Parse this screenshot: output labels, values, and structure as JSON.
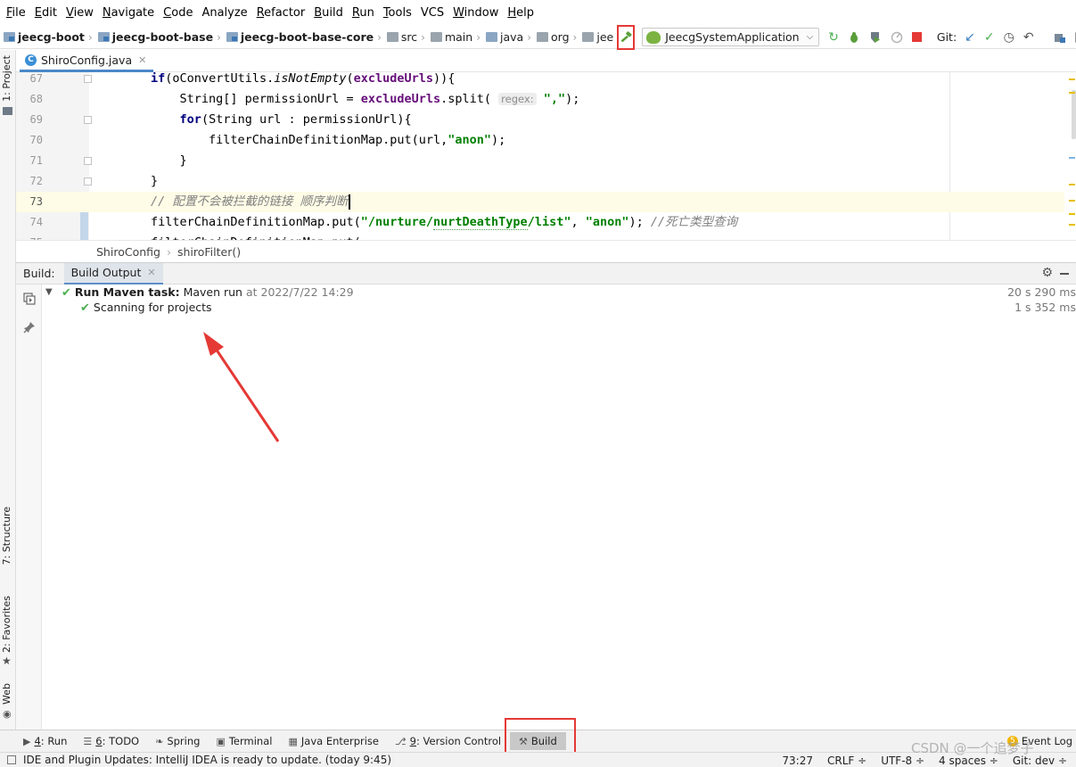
{
  "menu": [
    {
      "label": "File",
      "mnemonic": "F",
      "rest": "ile"
    },
    {
      "label": "Edit",
      "mnemonic": "E",
      "rest": "dit"
    },
    {
      "label": "View",
      "mnemonic": "V",
      "rest": "iew"
    },
    {
      "label": "Navigate",
      "mnemonic": "N",
      "rest": "avigate"
    },
    {
      "label": "Code",
      "mnemonic": "C",
      "rest": "ode"
    },
    {
      "label": "Analyze",
      "mnemonic": "",
      "rest": "Analyze"
    },
    {
      "label": "Refactor",
      "mnemonic": "R",
      "rest": "efactor"
    },
    {
      "label": "Build",
      "mnemonic": "B",
      "rest": "uild"
    },
    {
      "label": "Run",
      "mnemonic": "R",
      "rest": "un"
    },
    {
      "label": "Tools",
      "mnemonic": "T",
      "rest": "ools"
    },
    {
      "label": "VCS",
      "mnemonic": "",
      "rest": "VCS"
    },
    {
      "label": "Window",
      "mnemonic": "W",
      "rest": "indow"
    },
    {
      "label": "Help",
      "mnemonic": "H",
      "rest": "elp"
    }
  ],
  "breadcrumb": [
    {
      "label": "jeecg-boot",
      "bold": true,
      "icon": "module-folder-icon"
    },
    {
      "label": "jeecg-boot-base",
      "bold": true,
      "icon": "module-folder-icon"
    },
    {
      "label": "jeecg-boot-base-core",
      "bold": true,
      "icon": "module-folder-icon"
    },
    {
      "label": "src",
      "bold": false,
      "icon": "folder-icon"
    },
    {
      "label": "main",
      "bold": false,
      "icon": "folder-icon"
    },
    {
      "label": "java",
      "bold": false,
      "icon": "source-folder-icon"
    },
    {
      "label": "org",
      "bold": false,
      "icon": "package-icon"
    },
    {
      "label": "jee",
      "bold": false,
      "icon": "package-icon"
    }
  ],
  "toolbar": {
    "run_config": "JeecgSystemApplication",
    "git_label": "Git:"
  },
  "editor": {
    "tab_label": "ShiroConfig.java",
    "lines": [
      {
        "num": "67"
      },
      {
        "num": "68"
      },
      {
        "num": "69"
      },
      {
        "num": "70"
      },
      {
        "num": "71"
      },
      {
        "num": "72"
      },
      {
        "num": "73"
      },
      {
        "num": "74"
      },
      {
        "num": "75"
      }
    ],
    "hint_regex": "regex:",
    "breadcrumb": [
      "ShiroConfig",
      "shiroFilter()"
    ]
  },
  "left_strip": {
    "project": "1: Project",
    "structure": "7: Structure",
    "favorites": "2: Favorites",
    "web": "Web"
  },
  "build": {
    "title": "Build:",
    "tab": "Build Output",
    "rows": [
      {
        "bold": "Run Maven task:",
        "text": " Maven run",
        "meta": " at 2022/7/22 14:29",
        "time": "20 s 290 ms"
      },
      {
        "bold": "",
        "text": "Scanning for projects",
        "meta": "",
        "time": "1 s 352 ms"
      }
    ]
  },
  "bottom_tools": [
    {
      "num": "4",
      "label": ": Run",
      "icon": "run-icon"
    },
    {
      "num": "6",
      "label": ": TODO",
      "icon": "todo-icon"
    },
    {
      "num": "",
      "label": "Spring",
      "icon": "spring-icon"
    },
    {
      "num": "",
      "label": "Terminal",
      "icon": "terminal-icon"
    },
    {
      "num": "",
      "label": "Java Enterprise",
      "icon": "java-enterprise-icon"
    },
    {
      "num": "9",
      "label": ": Version Control",
      "icon": "version-control-icon"
    },
    {
      "num": "",
      "label": "Build",
      "icon": "hammer-icon"
    }
  ],
  "event_log": {
    "count": "5",
    "label": "Event Log"
  },
  "status": {
    "message": "IDE and Plugin Updates: IntelliJ IDEA is ready to update. (today 9:45)",
    "position": "73:27",
    "line_sep": "CRLF ÷",
    "encoding": "UTF-8 ÷",
    "indent": "4 spaces ÷",
    "git": "Git: dev ÷"
  },
  "watermark": "CSDN @一个追梦子",
  "colors": {
    "accent": "#4a88c7",
    "highlight_box": "#e53935",
    "success": "#4caf50"
  }
}
